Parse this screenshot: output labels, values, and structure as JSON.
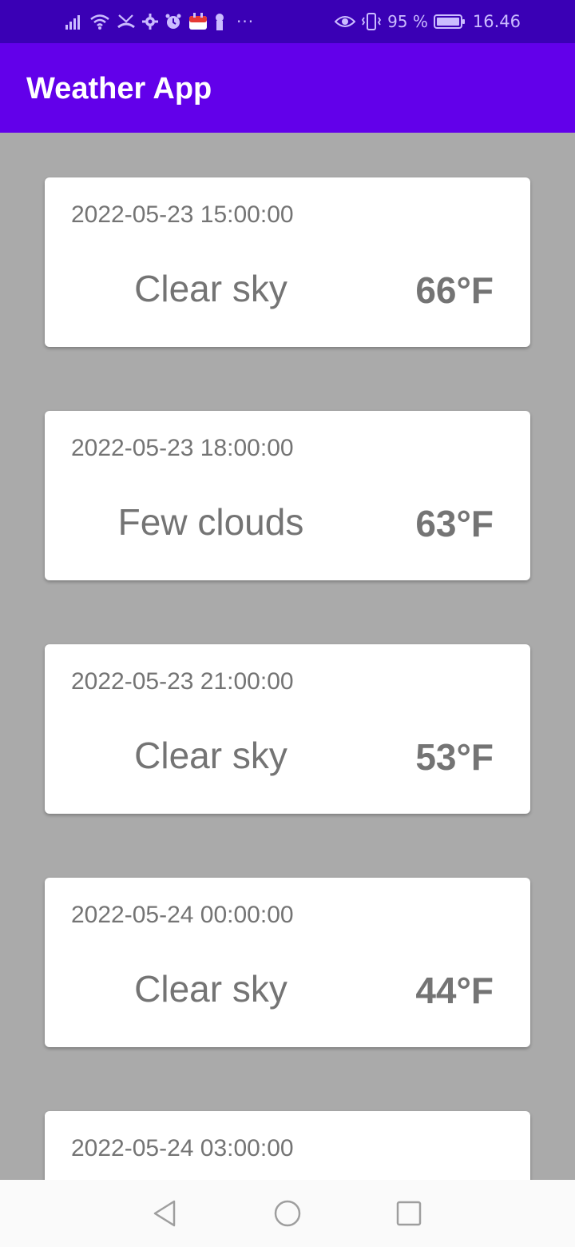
{
  "status_bar": {
    "battery_percent": "95 %",
    "time": "16.46",
    "icons_left": [
      "signal-icon",
      "wifi-icon",
      "missed-call-icon",
      "settings-icon",
      "alarm-icon",
      "calendar-icon",
      "vpn-key-icon"
    ],
    "more": "···",
    "icons_right": [
      "eye-comfort-icon",
      "vibrate-icon",
      "battery-icon"
    ]
  },
  "app_bar": {
    "title": "Weather App"
  },
  "forecasts": [
    {
      "datetime": "2022-05-23 15:00:00",
      "condition": "Clear sky",
      "temperature": "66°F"
    },
    {
      "datetime": "2022-05-23 18:00:00",
      "condition": "Few clouds",
      "temperature": "63°F"
    },
    {
      "datetime": "2022-05-23 21:00:00",
      "condition": "Clear sky",
      "temperature": "53°F"
    },
    {
      "datetime": "2022-05-24 00:00:00",
      "condition": "Clear sky",
      "temperature": "44°F"
    },
    {
      "datetime": "2022-05-24 03:00:00",
      "condition": "",
      "temperature": ""
    }
  ],
  "nav_bar": {
    "buttons": [
      "back-icon",
      "home-icon",
      "recents-icon"
    ]
  },
  "colors": {
    "status_bar": "#3a00b5",
    "app_bar": "#6200ea",
    "background": "#aaaaaa",
    "card": "#ffffff",
    "card_text": "#747474"
  }
}
